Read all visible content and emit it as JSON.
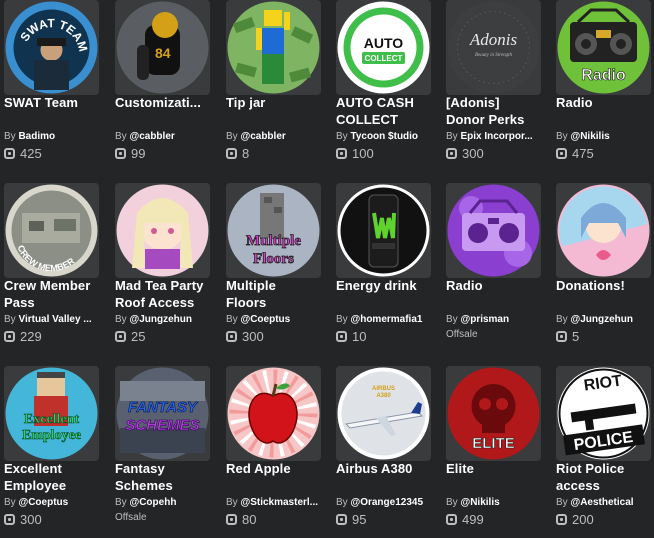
{
  "by_prefix": "By",
  "items": [
    {
      "name": "SWAT Team",
      "creator": "Badimo",
      "price": "425",
      "icon": "swat-team-icon",
      "art": "swat",
      "art_text": "SWAT TEAM"
    },
    {
      "name": "Customizati...",
      "creator": "@cabbler",
      "price": "99",
      "icon": "football-player-icon",
      "art": "football"
    },
    {
      "name": "Tip jar",
      "creator": "@cabbler",
      "price": "8",
      "icon": "money-avatar-icon",
      "art": "money"
    },
    {
      "name": "AUTO CASH\nCOLLECT",
      "creator": "Tycoon $tudio",
      "price": "100",
      "icon": "auto-collect-icon",
      "art": "auto",
      "art_text": "AUTO",
      "art_sub": "COLLECT"
    },
    {
      "name": "[Adonis]\nDonor Perks",
      "creator": "Epix Incorpor...",
      "price": "300",
      "icon": "adonis-logo-icon",
      "art": "adonis",
      "art_text": "Adonis",
      "art_sub": "Beauty in Strength"
    },
    {
      "name": "Radio",
      "creator": "@Nikilis",
      "price": "475",
      "icon": "radio-boombox-icon",
      "art": "radio1",
      "art_text": "Radio"
    },
    {
      "name": "Crew Member\nPass",
      "creator": "Virtual Valley ...",
      "price": "229",
      "icon": "crew-member-badge-icon",
      "art": "crew",
      "art_text": "CREW MEMBER"
    },
    {
      "name": "Mad Tea Party\nRoof Access",
      "creator": "@Jungzehun",
      "price": "25",
      "icon": "anime-girl-icon",
      "art": "teaparty"
    },
    {
      "name": "Multiple\nFloors",
      "creator": "@Coeptus",
      "price": "300",
      "icon": "multiple-floors-icon",
      "art": "floors",
      "art_text": "Multiple",
      "art_sub": "Floors"
    },
    {
      "name": "Energy drink",
      "creator": "@homermafia1",
      "price": "10",
      "icon": "energy-drink-can-icon",
      "art": "energy"
    },
    {
      "name": "Radio",
      "creator": "@prisman",
      "price": "",
      "offsale": "Offsale",
      "icon": "radio-purple-icon",
      "art": "radio2"
    },
    {
      "name": "Donations!",
      "creator": "@Jungzehun",
      "price": "5",
      "icon": "donation-girl-icon",
      "art": "donations"
    },
    {
      "name": "Excellent\nEmployee",
      "creator": "@Coeptus",
      "price": "300",
      "icon": "excellent-employee-icon",
      "art": "employee",
      "art_text": "Excellent",
      "art_sub": "Employee"
    },
    {
      "name": "Fantasy\nSchemes",
      "creator": "@Copehh",
      "price": "",
      "offsale": "Offsale",
      "icon": "fantasy-schemes-icon",
      "art": "fantasy",
      "art_text": "FANTASY",
      "art_sub": "SCHEMES"
    },
    {
      "name": "Red Apple",
      "creator": "@Stickmasterl...",
      "price": "80",
      "icon": "red-apple-icon",
      "art": "apple"
    },
    {
      "name": "Airbus A380",
      "creator": "@Orange12345",
      "price": "95",
      "icon": "airplane-icon",
      "art": "airbus",
      "art_text": "AIRBUS",
      "art_sub": "A380"
    },
    {
      "name": "Elite",
      "creator": "@Nikilis",
      "price": "499",
      "icon": "elite-skull-icon",
      "art": "elite",
      "art_text": "ELITE"
    },
    {
      "name": "Riot Police\naccess",
      "creator": "@Aesthetical",
      "price": "200",
      "icon": "riot-police-icon",
      "art": "riot",
      "art_text": "RIOT",
      "art_sub": "POLICE"
    }
  ]
}
